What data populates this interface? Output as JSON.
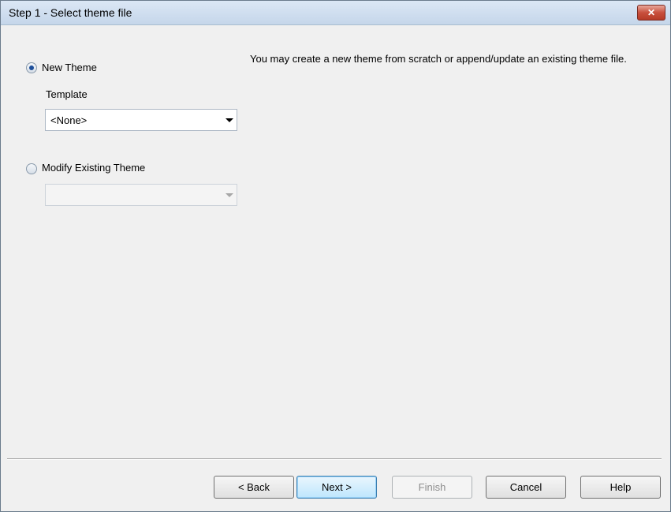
{
  "window": {
    "title": "Step 1 - Select theme file"
  },
  "options": {
    "new_theme": {
      "label": "New Theme",
      "selected": true
    },
    "template_label": "Template",
    "template_value": "<None>",
    "modify_existing": {
      "label": "Modify Existing Theme",
      "selected": false
    },
    "existing_value": ""
  },
  "description": "You may create a new theme from scratch or append/update an existing theme file.",
  "buttons": {
    "back": "< Back",
    "next": "Next >",
    "finish": "Finish",
    "cancel": "Cancel",
    "help": "Help"
  },
  "icons": {
    "close": "close-icon"
  }
}
